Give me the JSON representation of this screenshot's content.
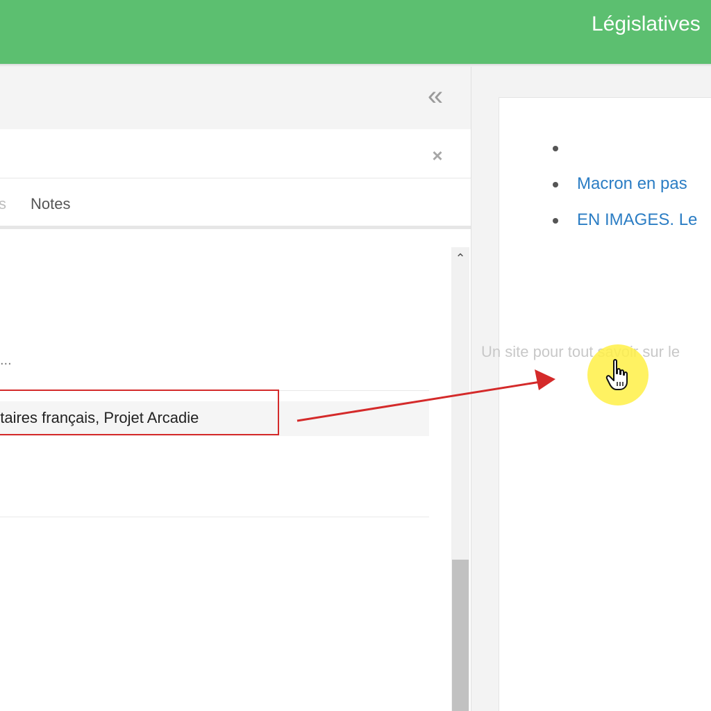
{
  "header": {
    "title": "Législatives"
  },
  "left_panel": {
    "tabs": [
      {
        "label": "s"
      },
      {
        "label": "Notes"
      }
    ],
    "list": {
      "truncated_text": "...",
      "selected_item_text": "ntaires français, Projet Arcadie"
    }
  },
  "right_panel": {
    "news_items": [
      {
        "label": ""
      },
      {
        "label": "Macron en pas"
      },
      {
        "label": "EN IMAGES. Le"
      }
    ],
    "footer_text": "Un site pour tout savoir sur le"
  },
  "icons": {
    "collapse": "double-chevron-left-icon",
    "close": "close-icon",
    "scroll_up": "chevron-up-icon",
    "cursor": "hand-pointer-icon"
  },
  "colors": {
    "header_bg": "#5cbf70",
    "link": "#2b7dc4",
    "annotation_red": "#d42a2a",
    "cursor_halo": "#fff046"
  }
}
